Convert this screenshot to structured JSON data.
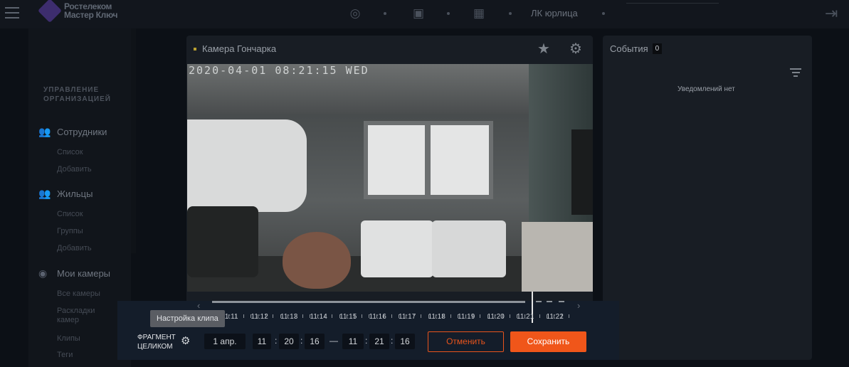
{
  "header": {
    "brand_line1": "Ростелеком",
    "brand_line2": "Мастер Ключ",
    "account_label": "ЛК юрлица"
  },
  "sidebar": {
    "section_title_line1": "УПРАВЛЕНИЕ",
    "section_title_line2": "ОРГАНИЗАЦИЕЙ",
    "groups": [
      {
        "label": "Сотрудники",
        "items": [
          "Список",
          "Добавить"
        ]
      },
      {
        "label": "Жильцы",
        "items": [
          "Список",
          "Группы",
          "Добавить"
        ]
      },
      {
        "label": "Мои камеры",
        "items": [
          "Все камеры",
          "Раскладки камер",
          "Клипы",
          "Теги"
        ]
      }
    ]
  },
  "camera": {
    "title": "Камера Гончарка",
    "timestamp_overlay": "2020-04-01 08:21:15 WED"
  },
  "events": {
    "title": "События",
    "count": "0",
    "empty_text": "Уведомлений нет"
  },
  "timeline": {
    "labels": [
      "11:11",
      "11:12",
      "11:13",
      "11:14",
      "11:15",
      "11:16",
      "11:17",
      "11:18",
      "11:19",
      "11:20",
      "11:21",
      "11:22"
    ]
  },
  "clip": {
    "tooltip": "Настройка клипа",
    "fragment_line1": "ФРАГМЕНТ",
    "fragment_line2": "ЦЕЛИКОМ",
    "date": "1 апр.",
    "start_h": "11",
    "start_m": "20",
    "start_s": "16",
    "range_sep": "—",
    "end_h": "11",
    "end_m": "21",
    "end_s": "16",
    "cancel_label": "Отменить",
    "save_label": "Сохранить"
  },
  "colors": {
    "accent": "#f0561a",
    "status_dot": "#b8a030"
  }
}
